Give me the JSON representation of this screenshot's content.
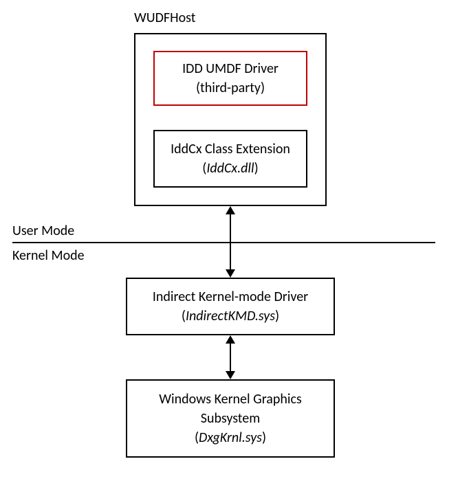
{
  "diagram": {
    "host_label": "WUDFHost",
    "idd_driver": {
      "line1": "IDD UMDF Driver",
      "line2": "(third-party)"
    },
    "iddcx_ext": {
      "line1": "IddCx Class Extension",
      "line2_prefix": "(",
      "line2_italic": "IddCx.dll",
      "line2_suffix": ")"
    },
    "user_mode_label": "User Mode",
    "kernel_mode_label": "Kernel Mode",
    "indirect_kmd": {
      "line1": "Indirect Kernel-mode Driver",
      "line2_prefix": "(",
      "line2_italic": "IndirectKMD.sys",
      "line2_suffix": ")"
    },
    "dxgkrnl": {
      "line1": "Windows Kernel Graphics",
      "line2": "Subsystem",
      "line3_prefix": "(",
      "line3_italic": "DxgKrnl.sys",
      "line3_suffix": ")"
    }
  }
}
